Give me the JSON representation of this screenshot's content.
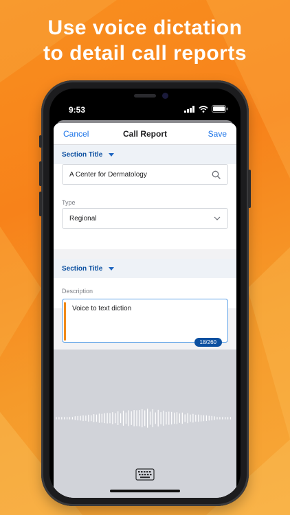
{
  "marketing": {
    "headline_line1": "Use voice dictation",
    "headline_line2": "to detail call reports"
  },
  "status_bar": {
    "time": "9:53"
  },
  "nav": {
    "cancel_label": "Cancel",
    "title": "Call Report",
    "save_label": "Save"
  },
  "section1": {
    "title": "Section Title",
    "account_value": "A Center for Dermatology",
    "type_label": "Type",
    "type_value": "Regional"
  },
  "section2": {
    "title": "Section Title",
    "description_label": "Description",
    "description_value": "Voice to text diction",
    "char_count": "18/260"
  },
  "icons": {
    "search": "search-icon",
    "dropdown": "chevron-down-icon",
    "keyboard": "keyboard-icon",
    "section_toggle": "caret-down-icon"
  },
  "colors": {
    "accent": "#1a73e8",
    "section_title": "#0b4fa0",
    "highlight_bar": "#f08a1a",
    "background": "#f98f1f"
  }
}
